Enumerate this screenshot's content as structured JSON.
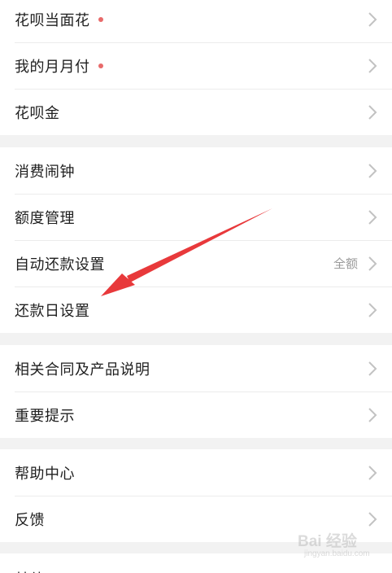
{
  "groups": [
    {
      "items": [
        {
          "label": "花呗当面花",
          "badge": true
        },
        {
          "label": "我的月月付",
          "badge": true
        },
        {
          "label": "花呗金",
          "badge": false
        }
      ]
    },
    {
      "items": [
        {
          "label": "消费闹钟",
          "badge": false
        },
        {
          "label": "额度管理",
          "badge": false
        },
        {
          "label": "自动还款设置",
          "badge": false,
          "value": "全额"
        },
        {
          "label": "还款日设置",
          "badge": false
        }
      ]
    },
    {
      "items": [
        {
          "label": "相关合同及产品说明",
          "badge": false
        },
        {
          "label": "重要提示",
          "badge": false
        }
      ]
    },
    {
      "items": [
        {
          "label": "帮助中心",
          "badge": false
        },
        {
          "label": "反馈",
          "badge": false
        }
      ]
    },
    {
      "items": [
        {
          "label": "其他",
          "badge": false
        }
      ]
    }
  ],
  "watermark": {
    "main": "Bai 经验",
    "sub": "jingyan.baidu.com"
  },
  "colors": {
    "badge": "#e86a6a",
    "annotation_arrow": "#e8393b",
    "chevron": "#c2c2c2"
  }
}
